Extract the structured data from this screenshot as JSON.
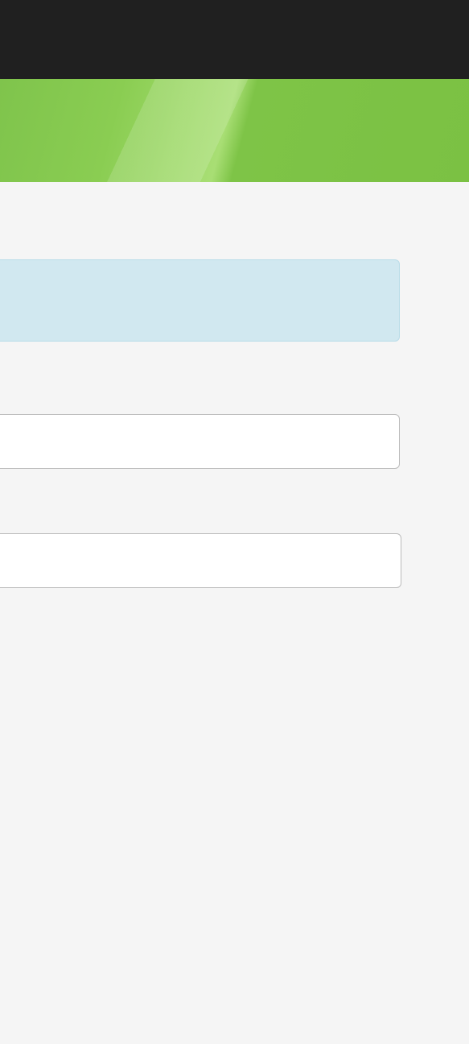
{
  "form": {
    "info_message": "",
    "field1_value": "",
    "field1_placeholder": "",
    "field2_value": "",
    "field2_placeholder": ""
  }
}
